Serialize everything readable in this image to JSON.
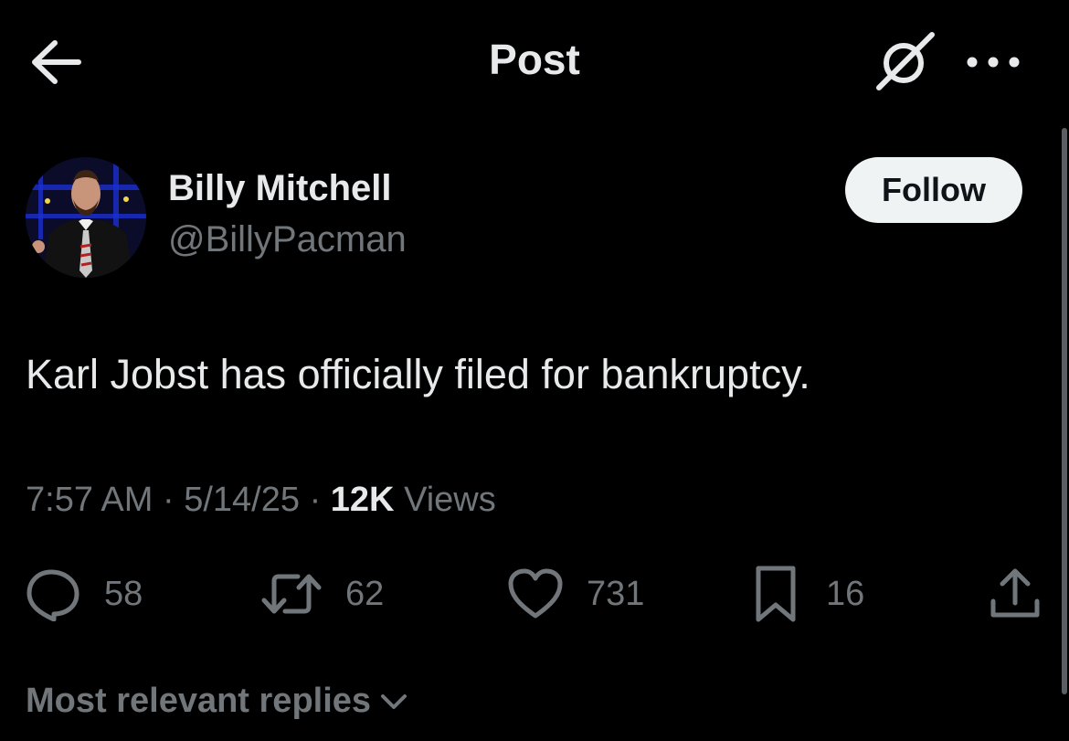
{
  "header": {
    "title": "Post",
    "back_icon": "arrow-left-icon",
    "grok_icon": "grok-icon",
    "more_icon": "more-horizontal-icon"
  },
  "author": {
    "name": "Billy Mitchell",
    "handle": "@BillyPacman",
    "follow_label": "Follow"
  },
  "post": {
    "text": "Karl Jobst has officially filed for bankruptcy.",
    "time": "7:57 AM",
    "date": "5/14/25",
    "views_count": "12K",
    "views_label": "Views",
    "separator": "·"
  },
  "actions": {
    "replies": "58",
    "reposts": "62",
    "likes": "731",
    "bookmarks": "16"
  },
  "replies_sort": {
    "label": "Most relevant replies"
  },
  "colors": {
    "background": "#000000",
    "primary_text": "#e7e9ea",
    "secondary_text": "#71767b",
    "follow_bg": "#eff3f4"
  }
}
